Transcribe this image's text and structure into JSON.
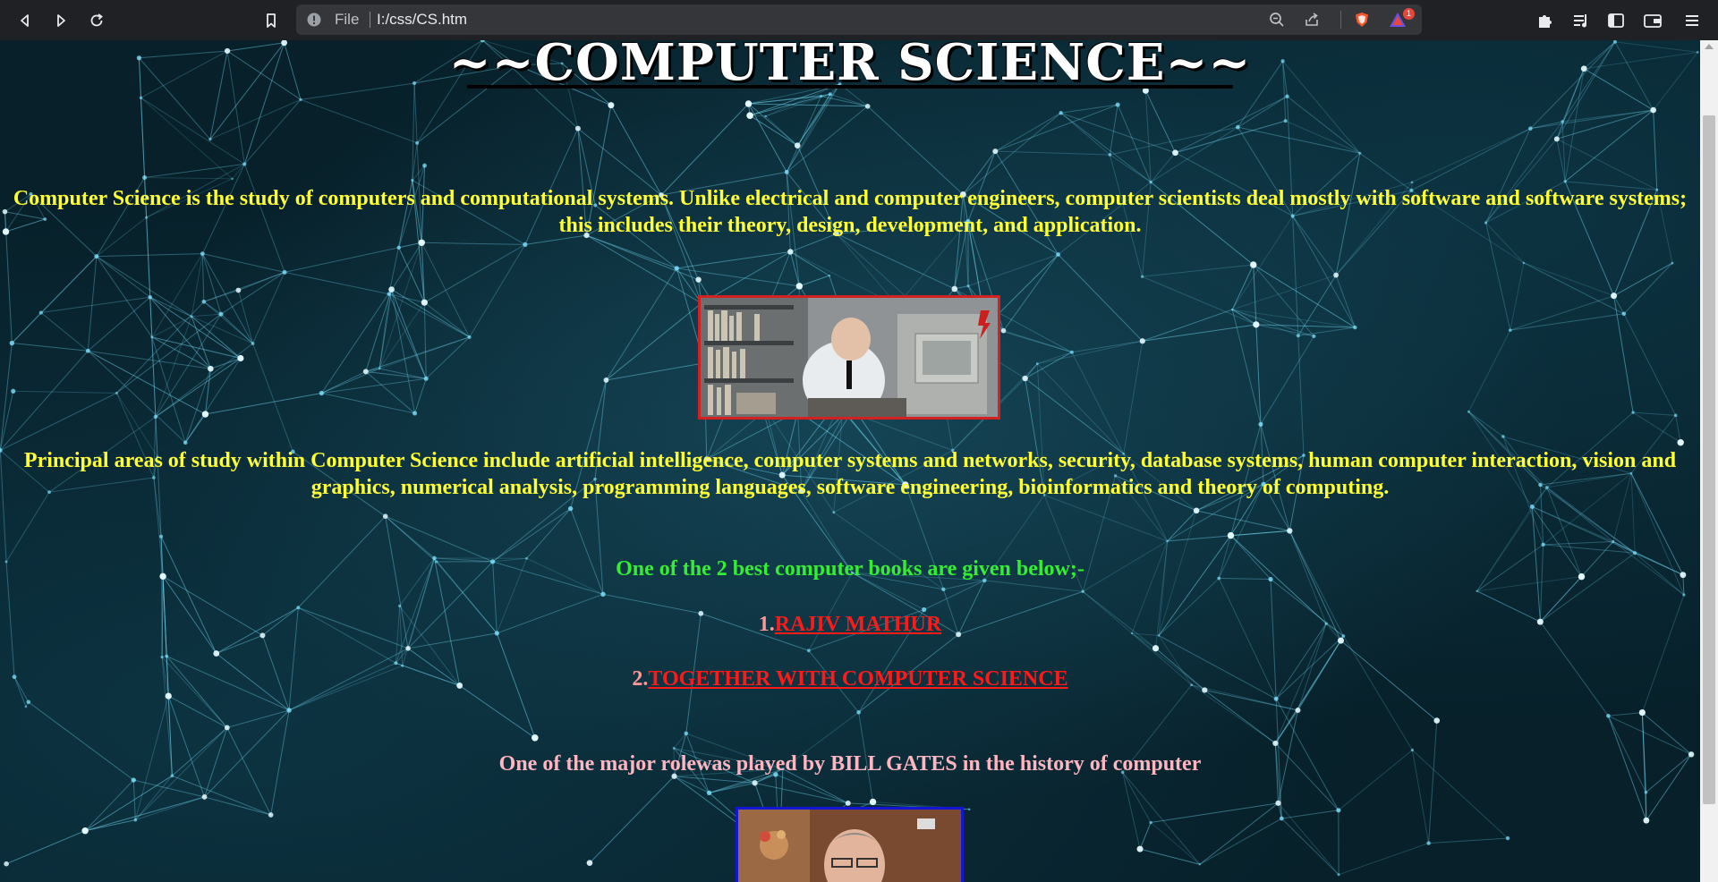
{
  "browser": {
    "scheme_label": "File",
    "url": "I:/css/CS.htm",
    "notification_count": "1",
    "icons": {
      "back": "back-arrow-icon",
      "forward": "forward-arrow-icon",
      "reload": "reload-icon",
      "bookmark": "bookmark-icon",
      "info": "info-icon",
      "zoom": "zoom-icon",
      "share": "share-icon",
      "brave_shield": "brave-shield-icon",
      "brave_rewards": "brave-rewards-icon",
      "extensions": "puzzle-icon",
      "media": "media-queue-icon",
      "sidebar": "sidebar-icon",
      "wallet": "wallet-icon",
      "menu": "menu-icon"
    }
  },
  "page": {
    "title": "~~COMPUTER SCIENCE~~",
    "intro": "Computer Science is the study of computers and computational systems. Unlike electrical and computer engineers, computer scientists deal mostly with software and software systems; this includes their theory, design, development, and application.",
    "areas": "Principal areas of study within Computer Science include artificial intelligence, computer systems and networks, security, database systems, human computer interaction, vision and graphics, numerical analysis, programming languages, software engineering, bioinformatics and theory of computing.",
    "books_heading": "One of the 2 best computer books are given below;-",
    "books": [
      {
        "number": "1.",
        "title": "RAJIV MATHUR"
      },
      {
        "number": "2.",
        "title": "TOGETHER WITH COMPUTER SCIENCE"
      }
    ],
    "gates_line": "One of the major rolewas played by BILL GATES in the history of computer"
  },
  "colors": {
    "intro_text": "#ffff33",
    "books_heading": "#33ee33",
    "book_link": "#ff1a1a",
    "gates_text": "#ffb6c1",
    "image1_border": "#d42020",
    "image2_border": "#1515d6"
  }
}
